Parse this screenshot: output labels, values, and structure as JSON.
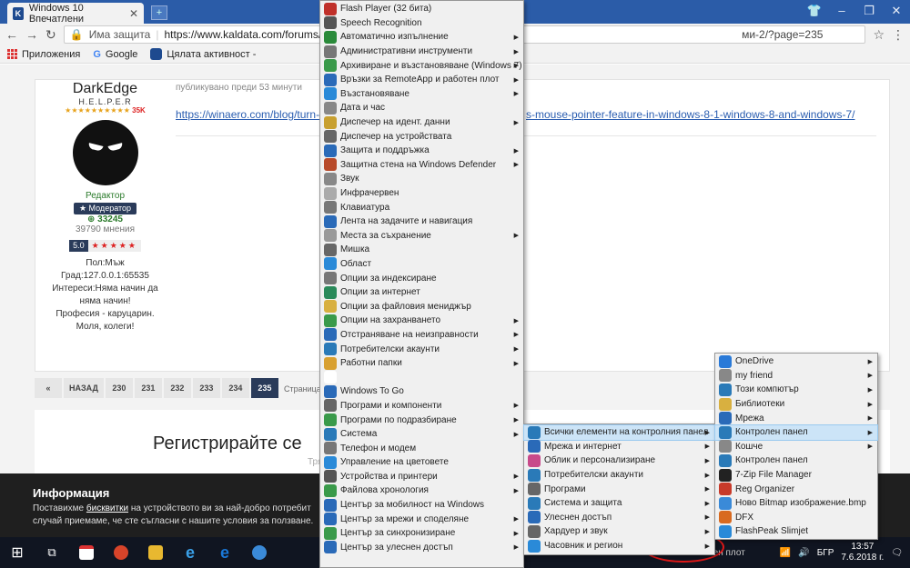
{
  "browser": {
    "tab_title": "Windows 10 Впечатлени",
    "security": "Има защита",
    "url": "https://www.kaldata.com/forums/topic",
    "url_tail": "ми-2/?page=235"
  },
  "bookmarks": [
    "Приложения",
    "Google",
    "Цялата активност -"
  ],
  "post": {
    "username": "DarkEdge",
    "rank": "H.E.L.P.E.R",
    "rep_stars": "★★★★★★★★★★",
    "rep_tag": "35K",
    "role": "Редактор",
    "moderator": "Модератор",
    "reputation": "33245",
    "opinions": "39790 мнения",
    "rating": "5.0",
    "rating_stars": "★★★★★",
    "info": [
      "Пол:Мъж",
      "Град:127.0.0.1:65535",
      "Интереси:Няма начин да",
      "няма начин!",
      "Професия - каруцарин.",
      "Моля, колеги!"
    ],
    "meta": "публикувано преди 53 минути",
    "link_start": "https://winaero.com/blog/turn-o",
    "link_end": "s-mouse-pointer-feature-in-windows-8-1-windows-8-and-windows-7/"
  },
  "pager": {
    "items": [
      "«",
      "НАЗАД",
      "230",
      "231",
      "232",
      "233",
      "234",
      "235"
    ],
    "label": "Страница"
  },
  "register": {
    "title": "Регистрирайте се",
    "sub": "Тря"
  },
  "cookie": {
    "heading": "Информация",
    "text1": "Поставихме ",
    "bold": "бисквитки",
    "text2": " на устройството ви за най-добро потребит",
    "text3": "случай приемаме, че сте съгласни с нашите условия за ползване."
  },
  "menu_main": [
    {
      "label": "Flash Player (32 бита)",
      "icon": "flash-icon",
      "color": "#c0302a",
      "sub": false
    },
    {
      "label": "Speech Recognition",
      "icon": "mic-icon",
      "color": "#555",
      "sub": false
    },
    {
      "label": "Автоматично изпълнение",
      "icon": "autoplay-icon",
      "color": "#2a8a3a",
      "sub": true
    },
    {
      "label": "Административни инструменти",
      "icon": "tools-icon",
      "color": "#777",
      "sub": true
    },
    {
      "label": "Архивиране и възстановяване (Windows 7)",
      "icon": "backup-icon",
      "color": "#3a9a4a",
      "sub": true
    },
    {
      "label": "Връзки за RemoteApp и работен плот",
      "icon": "remote-icon",
      "color": "#2a6ab8",
      "sub": true
    },
    {
      "label": "Възстановяване",
      "icon": "recovery-icon",
      "color": "#2a8ad8",
      "sub": true
    },
    {
      "label": "Дата и час",
      "icon": "clock-icon",
      "color": "#888",
      "sub": false
    },
    {
      "label": "Диспечер на идент. данни",
      "icon": "credential-icon",
      "color": "#c8a030",
      "sub": true
    },
    {
      "label": "Диспечер на устройствата",
      "icon": "device-icon",
      "color": "#666",
      "sub": false
    },
    {
      "label": "Защита и поддръжка",
      "icon": "flag-icon",
      "color": "#2a6ab8",
      "sub": true
    },
    {
      "label": "Защитна стена на Windows Defender",
      "icon": "firewall-icon",
      "color": "#b84a2a",
      "sub": true
    },
    {
      "label": "Звук",
      "icon": "speaker-icon",
      "color": "#888",
      "sub": false
    },
    {
      "label": "Инфрачервен",
      "icon": "infrared-icon",
      "color": "#aaa",
      "sub": false
    },
    {
      "label": "Клавиатура",
      "icon": "keyboard-icon",
      "color": "#777",
      "sub": false
    },
    {
      "label": "Лента на задачите и навигация",
      "icon": "taskbar-icon",
      "color": "#2a6ab8",
      "sub": false
    },
    {
      "label": "Места за съхранение",
      "icon": "storage-icon",
      "color": "#999",
      "sub": true
    },
    {
      "label": "Мишка",
      "icon": "mouse-icon",
      "color": "#666",
      "sub": false
    },
    {
      "label": "Област",
      "icon": "globe-icon",
      "color": "#2a8ad8",
      "sub": false
    },
    {
      "label": "Опции за индексиране",
      "icon": "index-icon",
      "color": "#777",
      "sub": false
    },
    {
      "label": "Опции за интернет",
      "icon": "internet-icon",
      "color": "#2a8a5a",
      "sub": false
    },
    {
      "label": "Опции за файловия мениджър",
      "icon": "folder-options-icon",
      "color": "#d8b040",
      "sub": false
    },
    {
      "label": "Опции на захранването",
      "icon": "power-icon",
      "color": "#3a9a4a",
      "sub": true
    },
    {
      "label": "Отстраняване на неизправности",
      "icon": "troubleshoot-icon",
      "color": "#2a6ab8",
      "sub": true
    },
    {
      "label": "Потребителски акаунти",
      "icon": "users-icon",
      "color": "#2a7ab8",
      "sub": true
    },
    {
      "label": "Работни папки",
      "icon": "work-folders-icon",
      "color": "#d8a030",
      "sub": true
    },
    {
      "label": "",
      "icon": "blank-icon",
      "color": "#fff",
      "sub": false
    },
    {
      "label": "Windows To Go",
      "icon": "windows-to-go-icon",
      "color": "#2a6ab8",
      "sub": false
    },
    {
      "label": "Програми и компоненти",
      "icon": "programs-icon",
      "color": "#666",
      "sub": true
    },
    {
      "label": "Програми по подразбиране",
      "icon": "default-programs-icon",
      "color": "#3a9a4a",
      "sub": true
    },
    {
      "label": "Система",
      "icon": "system-icon",
      "color": "#2a7ab8",
      "sub": true
    },
    {
      "label": "Телефон и модем",
      "icon": "phone-icon",
      "color": "#777",
      "sub": false
    },
    {
      "label": "Управление на цветовете",
      "icon": "color-icon",
      "color": "#2a8ad8",
      "sub": false
    },
    {
      "label": "Устройства и принтери",
      "icon": "printer-icon",
      "color": "#555",
      "sub": true
    },
    {
      "label": "Файлова хронология",
      "icon": "history-icon",
      "color": "#3a9a4a",
      "sub": true
    },
    {
      "label": "Център за мобилност на Windows",
      "icon": "mobility-icon",
      "color": "#2a6ab8",
      "sub": false
    },
    {
      "label": "Център за мрежи и споделяне",
      "icon": "network-icon",
      "color": "#2a6ab8",
      "sub": true
    },
    {
      "label": "Център за синхронизиране",
      "icon": "sync-icon",
      "color": "#3a9a4a",
      "sub": true
    },
    {
      "label": "Център за улеснен достъп",
      "icon": "ease-access-icon",
      "color": "#2a6ab8",
      "sub": true
    }
  ],
  "menu_cp": [
    {
      "label": "Всички елементи на контролния панел",
      "icon": "control-panel-icon",
      "color": "#2a7ab8",
      "sub": true,
      "hl": true
    },
    {
      "label": "Мрежа и интернет",
      "icon": "network-icon",
      "color": "#2a6ab8",
      "sub": true
    },
    {
      "label": "Облик и персонализиране",
      "icon": "appearance-icon",
      "color": "#c84a8a",
      "sub": true
    },
    {
      "label": "Потребителски акаунти",
      "icon": "users-icon",
      "color": "#2a7ab8",
      "sub": true
    },
    {
      "label": "Програми",
      "icon": "programs-icon",
      "color": "#666",
      "sub": true
    },
    {
      "label": "Система и защита",
      "icon": "shield-icon",
      "color": "#2a7ab8",
      "sub": true
    },
    {
      "label": "Улеснен достъп",
      "icon": "ease-access-icon",
      "color": "#2a6ab8",
      "sub": true
    },
    {
      "label": "Хардуер и звук",
      "icon": "printer-icon",
      "color": "#666",
      "sub": true
    },
    {
      "label": "Часовник и регион",
      "icon": "clock-icon",
      "color": "#2a8ad8",
      "sub": true
    }
  ],
  "menu_desktop": [
    {
      "label": "OneDrive",
      "icon": "onedrive-icon",
      "color": "#2a7ad8",
      "sub": true
    },
    {
      "label": "my friend",
      "icon": "user-icon",
      "color": "#888",
      "sub": true
    },
    {
      "label": "Този компютър",
      "icon": "computer-icon",
      "color": "#2a7ab8",
      "sub": true
    },
    {
      "label": "Библиотеки",
      "icon": "library-icon",
      "color": "#d8b040",
      "sub": true
    },
    {
      "label": "Мрежа",
      "icon": "network-icon",
      "color": "#2a6ab8",
      "sub": true
    },
    {
      "label": "Контролен панел",
      "icon": "control-panel-icon",
      "color": "#2a7ab8",
      "sub": true,
      "hl": true
    },
    {
      "label": "Кошче",
      "icon": "recycle-bin-icon",
      "color": "#888",
      "sub": true
    },
    {
      "label": "Контролен панел",
      "icon": "control-panel-icon",
      "color": "#2a7ab8",
      "sub": false
    },
    {
      "label": "7-Zip File Manager",
      "icon": "7zip-icon",
      "color": "#222",
      "sub": false
    },
    {
      "label": "Reg Organizer",
      "icon": "reg-organizer-icon",
      "color": "#c83a2a",
      "sub": false
    },
    {
      "label": "Ново Bitmap изображение.bmp",
      "icon": "bitmap-icon",
      "color": "#3a8ad8",
      "sub": false
    },
    {
      "label": "DFX",
      "icon": "dfx-icon",
      "color": "#d86a20",
      "sub": false
    },
    {
      "label": "FlashPeak Slimjet",
      "icon": "slimjet-icon",
      "color": "#2a8ad8",
      "sub": false
    }
  ],
  "taskbar": {
    "desktop_label": "Работен плот",
    "lang": "БГР",
    "time": "13:57",
    "date": "7.6.2018 г."
  }
}
